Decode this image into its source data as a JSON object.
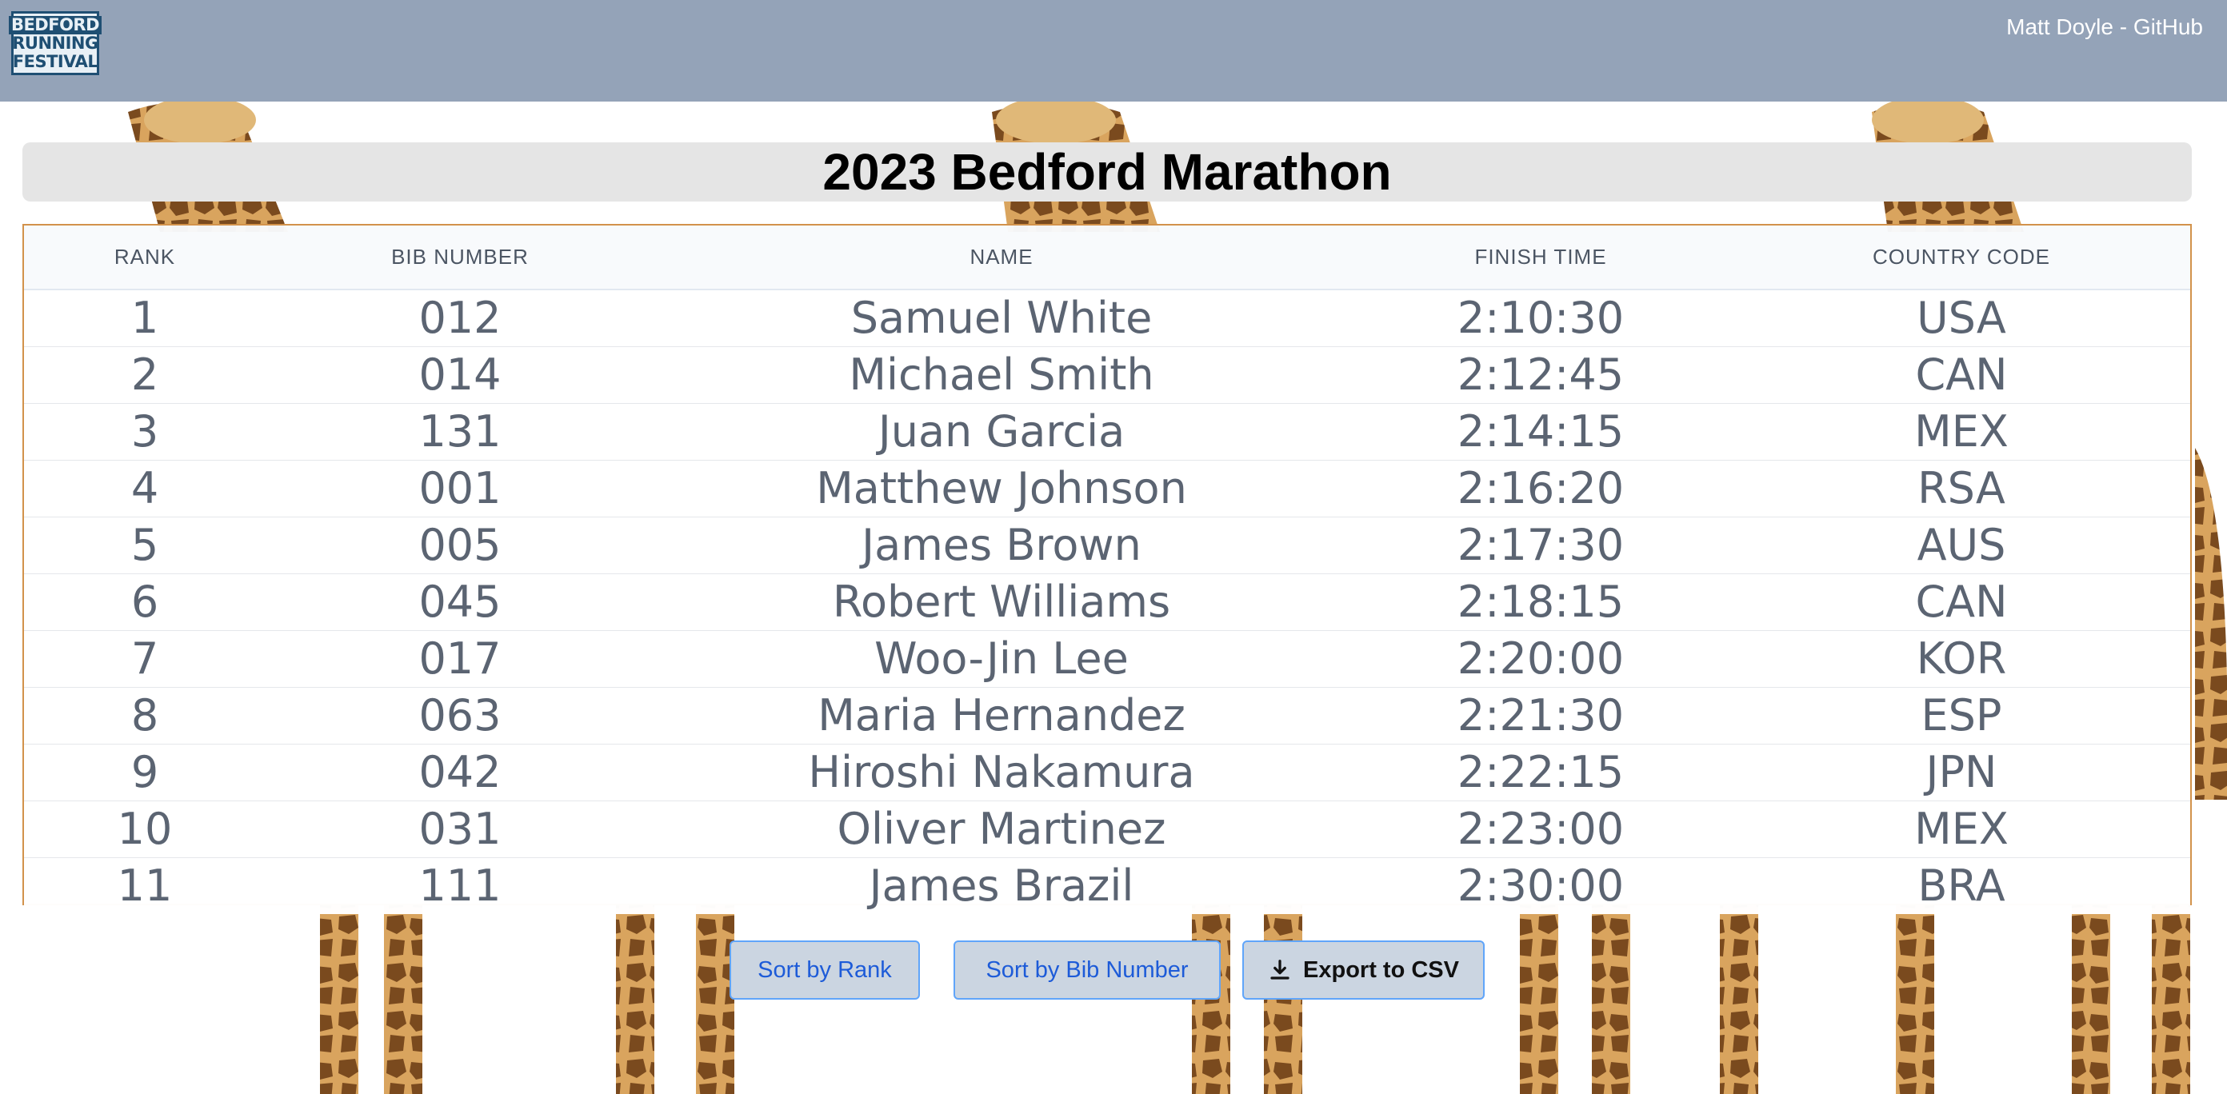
{
  "header": {
    "logo_lines": [
      "Bedford",
      "Running",
      "Festival"
    ],
    "link_label": "Matt Doyle - GitHub",
    "background_color": "#94a3b8"
  },
  "page": {
    "title": "2023 Bedford Marathon"
  },
  "table": {
    "columns": [
      "Rank",
      "Bib Number",
      "Name",
      "Finish Time",
      "Country Code"
    ],
    "rows": [
      {
        "rank": "1",
        "bib": "012",
        "name": "Samuel White",
        "time": "2:10:30",
        "country": "USA"
      },
      {
        "rank": "2",
        "bib": "014",
        "name": "Michael Smith",
        "time": "2:12:45",
        "country": "CAN"
      },
      {
        "rank": "3",
        "bib": "131",
        "name": "Juan Garcia",
        "time": "2:14:15",
        "country": "MEX"
      },
      {
        "rank": "4",
        "bib": "001",
        "name": "Matthew Johnson",
        "time": "2:16:20",
        "country": "RSA"
      },
      {
        "rank": "5",
        "bib": "005",
        "name": "James Brown",
        "time": "2:17:30",
        "country": "AUS"
      },
      {
        "rank": "6",
        "bib": "045",
        "name": "Robert Williams",
        "time": "2:18:15",
        "country": "CAN"
      },
      {
        "rank": "7",
        "bib": "017",
        "name": "Woo-Jin Lee",
        "time": "2:20:00",
        "country": "KOR"
      },
      {
        "rank": "8",
        "bib": "063",
        "name": "Maria Hernandez",
        "time": "2:21:30",
        "country": "ESP"
      },
      {
        "rank": "9",
        "bib": "042",
        "name": "Hiroshi Nakamura",
        "time": "2:22:15",
        "country": "JPN"
      },
      {
        "rank": "10",
        "bib": "031",
        "name": "Oliver Martinez",
        "time": "2:23:00",
        "country": "MEX"
      },
      {
        "rank": "11",
        "bib": "111",
        "name": "James Brazil",
        "time": "2:30:00",
        "country": "BRA"
      }
    ],
    "border_color": "#d2924b"
  },
  "actions": {
    "sort_rank_label": "Sort by Rank",
    "sort_bib_label": "Sort by Bib Number",
    "export_label": "Export to CSV",
    "export_icon": "download-icon"
  },
  "background": {
    "theme": "giraffe-pattern"
  }
}
